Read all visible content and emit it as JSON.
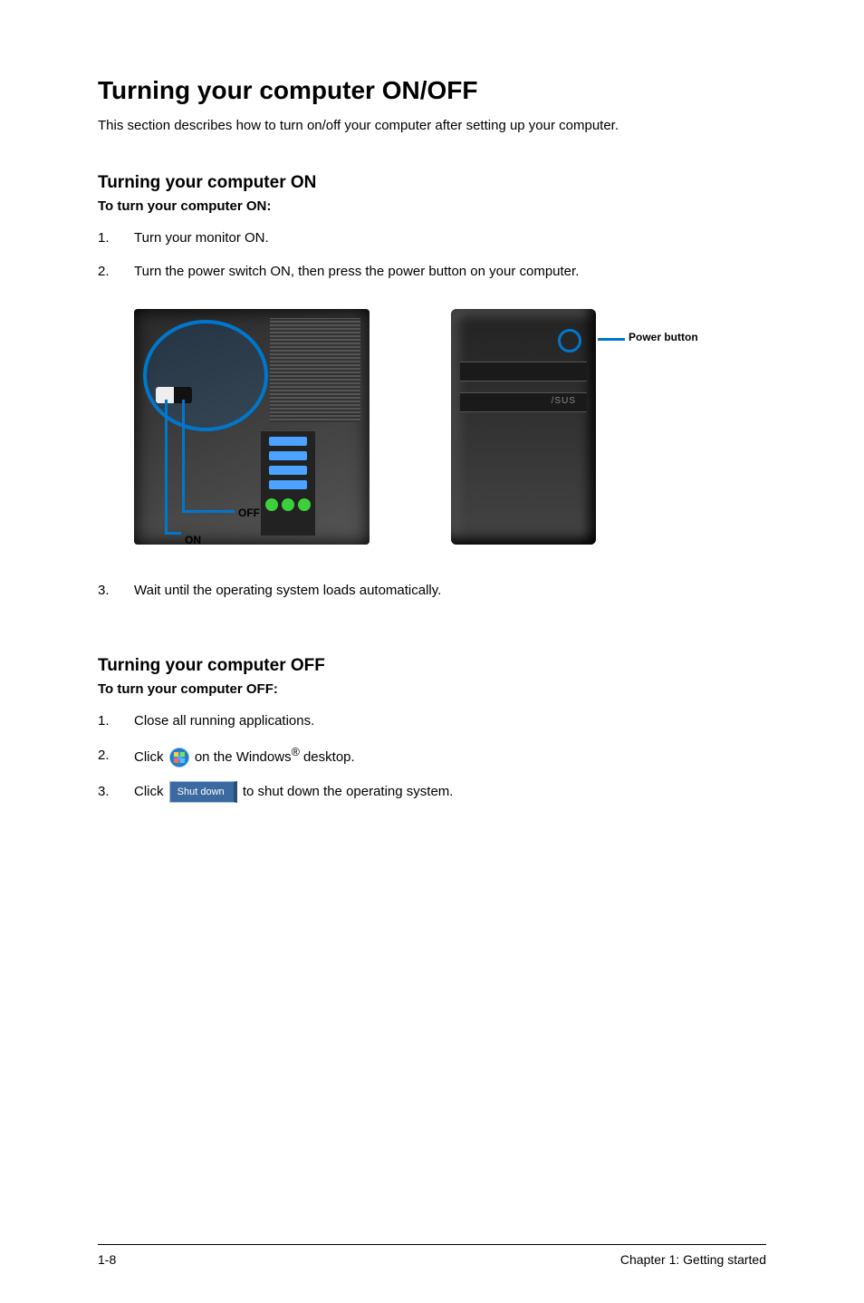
{
  "title": "Turning your computer ON/OFF",
  "intro": "This section describes how to turn on/off your computer after setting up your computer.",
  "on_section": {
    "heading": "Turning your computer ON",
    "sub": "To turn your computer ON:",
    "steps": [
      "Turn your monitor ON.",
      "Turn the power switch ON, then press the power button on your computer."
    ],
    "step3": "Wait until the operating system loads automatically.",
    "labels": {
      "off": "OFF",
      "on": "ON",
      "power_button": "Power button"
    }
  },
  "off_section": {
    "heading": "Turning your computer OFF",
    "sub": "To turn your computer OFF:",
    "steps": {
      "s1": "Close all running applications.",
      "s2_a": "Click",
      "s2_b": "on the Windows",
      "s2_c": "desktop.",
      "s3_a": "Click",
      "s3_b": "to shut down the operating system.",
      "shutdown_label": "Shut down"
    }
  },
  "footer": {
    "page": "1-8",
    "chapter": "Chapter 1: Getting started"
  }
}
